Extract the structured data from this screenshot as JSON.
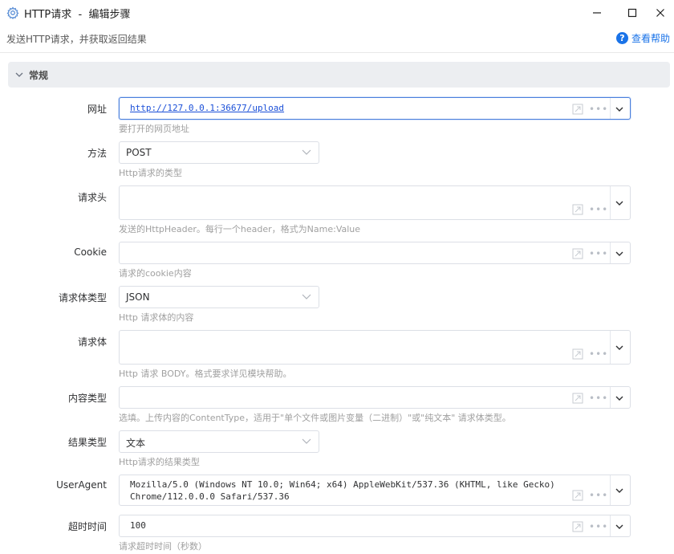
{
  "window": {
    "title": "HTTP请求  -  编辑步骤",
    "subtitle": "发送HTTP请求，并获取返回结果",
    "help_label": "查看帮助"
  },
  "section": {
    "title": "常规"
  },
  "fields": {
    "url": {
      "label": "网址",
      "value": "http://127.0.0.1:36677/upload",
      "hint": "要打开的网页地址"
    },
    "method": {
      "label": "方法",
      "value": "POST",
      "hint": "Http请求的类型"
    },
    "headers": {
      "label": "请求头",
      "value": "",
      "hint": "发送的HttpHeader。每行一个header，格式为Name:Value"
    },
    "cookie": {
      "label": "Cookie",
      "value": "",
      "hint": "请求的cookie内容"
    },
    "body_type": {
      "label": "请求体类型",
      "value": "JSON",
      "hint": "Http 请求体的内容"
    },
    "body": {
      "label": "请求体",
      "value": "",
      "hint": "Http 请求 BODY。格式要求详见模块帮助。"
    },
    "content_type": {
      "label": "内容类型",
      "value": "",
      "hint": "选填。上传内容的ContentType，适用于\"单个文件或图片变量（二进制）\"或\"纯文本\" 请求体类型。"
    },
    "result_type": {
      "label": "结果类型",
      "value": "文本",
      "hint": "Http请求的结果类型"
    },
    "user_agent": {
      "label": "UserAgent",
      "value_line1": "Mozilla/5.0 (Windows NT 10.0; Win64; x64) AppleWebKit/537.36 (KHTML, like Gecko)",
      "value_line2": "Chrome/112.0.0.0 Safari/537.36",
      "hint": ""
    },
    "timeout": {
      "label": "超时时间",
      "value": "100",
      "hint": "请求超时时间（秒数）"
    }
  },
  "colors": {
    "accent": "#1a73e8",
    "link": "#1a4fd8",
    "section_bg": "#eceef1"
  }
}
